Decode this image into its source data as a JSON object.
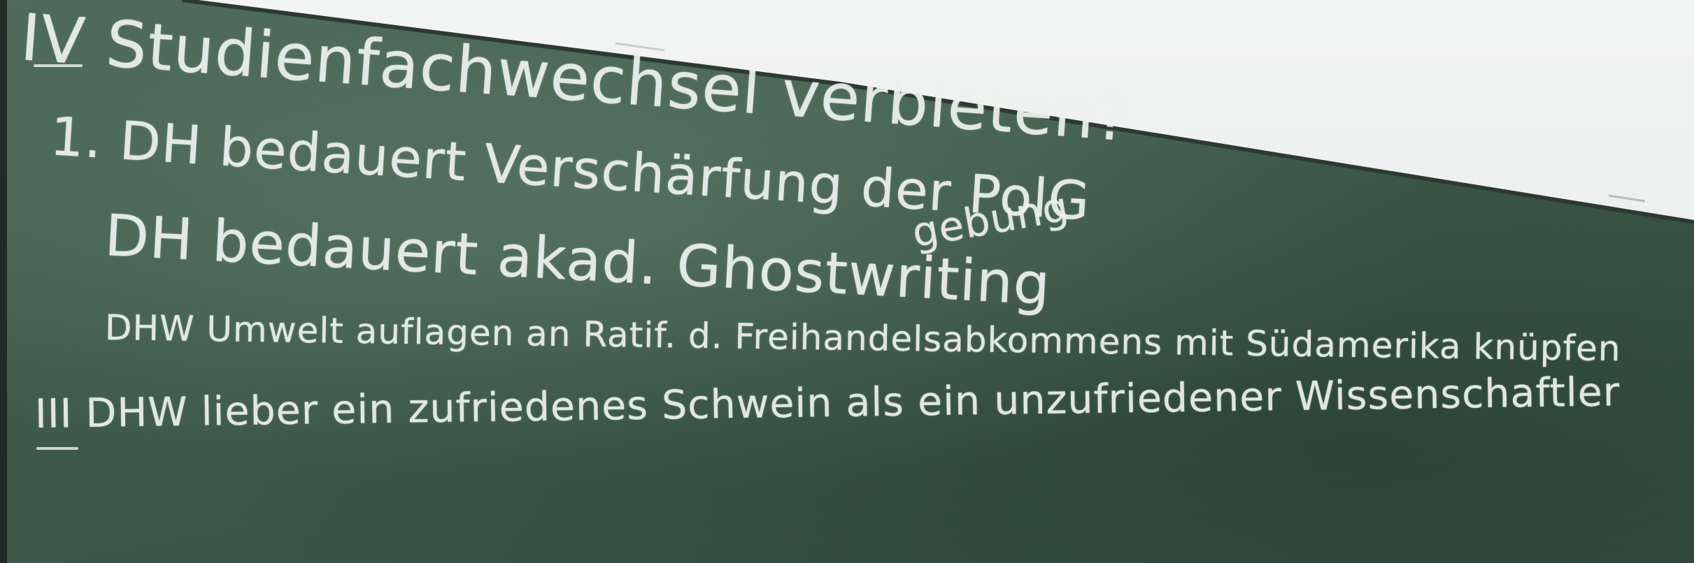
{
  "lines": [
    {
      "text": "IV Studienfachwechsel verbieten?"
    },
    {
      "text": "1. DH bedauert Verschärfung der PolG"
    },
    {
      "text": "gebung"
    },
    {
      "text": "DH bedauert akad. Ghostwriting"
    },
    {
      "text": "DHW Umwelt auflagen an Ratif. d. Freihandelsabkommens mit Südamerika knüpfen"
    },
    {
      "text": "III DHW lieber ein zufriedenes Schwein als ein unzufriedener Wissenschaftler"
    }
  ],
  "colors": {
    "board": "#3f5b4a",
    "chalk": "#eef2ee",
    "wall": "#eceded"
  }
}
